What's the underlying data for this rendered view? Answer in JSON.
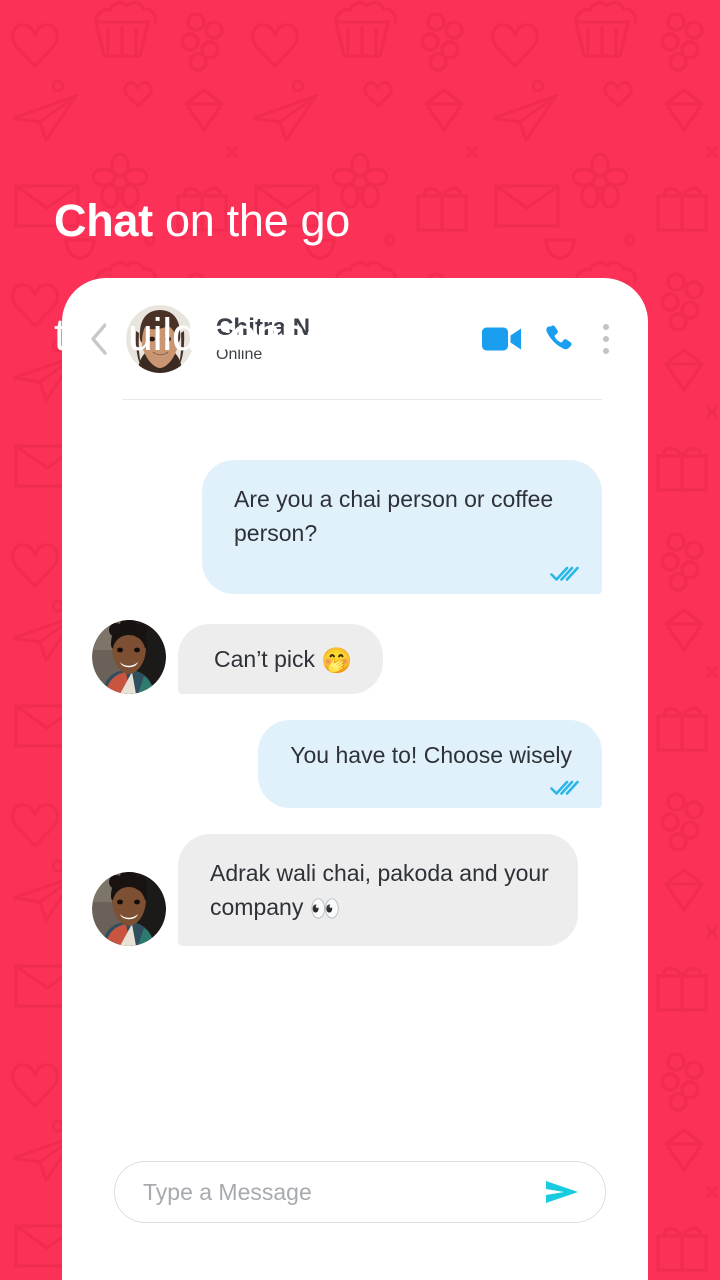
{
  "theme": {
    "background_color": "#fb3157",
    "doodle_color": "#e62549",
    "card_color": "#ffffff",
    "accent_blue": "#1a9ff0",
    "tick_blue": "#29b6e8",
    "send_cyan": "#19cbe0",
    "bubble_out_color": "#e1f1fb",
    "bubble_in_color": "#ededed",
    "text_color": "#2e3238"
  },
  "headline": {
    "bold_part": "Chat",
    "rest_line1": " on the go",
    "line2": "to build connections"
  },
  "chat": {
    "header": {
      "back_icon": "chevron-left-icon",
      "avatar_alt": "Chitra N profile photo",
      "contact_name": "Chitra N",
      "status": "Online",
      "video_icon": "video-camera-icon",
      "call_icon": "phone-icon",
      "menu_icon": "kebab-menu-icon"
    },
    "messages": [
      {
        "id": "m1",
        "direction": "out",
        "text": "Are you a chai person or coffee person?",
        "lines": 2,
        "ticks": "double-check-icon",
        "has_avatar": false
      },
      {
        "id": "m2",
        "direction": "in",
        "text": "Can’t pick ",
        "emoji": "🤭",
        "lines": 1,
        "ticks": null,
        "has_avatar": true
      },
      {
        "id": "m3",
        "direction": "out",
        "text": "You have to! Choose wisely",
        "lines": 1,
        "ticks": "double-check-icon",
        "has_avatar": false
      },
      {
        "id": "m4",
        "direction": "in",
        "text": "Adrak wali chai, pakoda and your company ",
        "emoji": "👀",
        "lines": 2,
        "ticks": null,
        "has_avatar": true
      }
    ],
    "composer": {
      "placeholder": "Type a Message",
      "value": "",
      "send_icon": "send-arrow-icon"
    }
  }
}
